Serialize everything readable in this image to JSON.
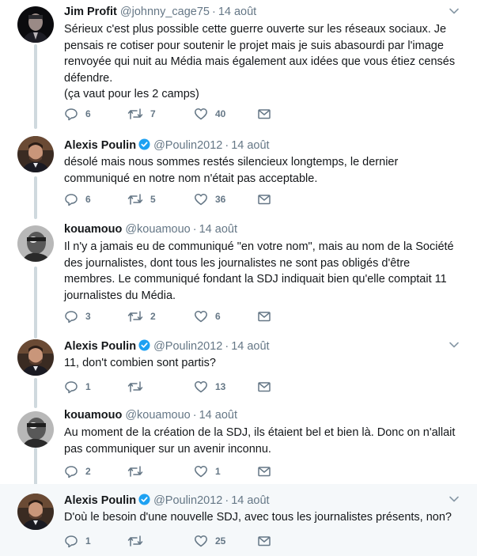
{
  "tweets": [
    {
      "display_name": "Jim Profit",
      "handle": "@johnny_cage75",
      "time": "14 août",
      "verified": false,
      "text": "Sérieux c'est plus possible cette guerre ouverte sur les réseaux sociaux. Je pensais re cotiser pour soutenir le projet mais je suis abasourdi par l'image renvoyée qui nuit au Média mais également aux idées que vous étiez censés défendre.\n(ça vaut pour les 2 camps)",
      "replies": "6",
      "retweets": "7",
      "likes": "40"
    },
    {
      "display_name": "Alexis Poulin",
      "handle": "@Poulin2012",
      "time": "14 août",
      "verified": true,
      "text": "désolé mais nous sommes restés silencieux longtemps, le dernier communiqué en notre nom n'était pas acceptable.",
      "replies": "6",
      "retweets": "5",
      "likes": "36"
    },
    {
      "display_name": "kouamouo",
      "handle": "@kouamouo",
      "time": "14 août",
      "verified": false,
      "text": "Il n'y a jamais eu de communiqué \"en votre nom\", mais au nom de la Société des journalistes, dont tous les journalistes ne sont pas obligés d'être membres. Le communiqué fondant la SDJ indiquait bien qu'elle comptait 11 journalistes du Média.",
      "replies": "3",
      "retweets": "2",
      "likes": "6"
    },
    {
      "display_name": "Alexis Poulin",
      "handle": "@Poulin2012",
      "time": "14 août",
      "verified": true,
      "text": "11, don't combien sont partis?",
      "replies": "1",
      "retweets": "",
      "likes": "13"
    },
    {
      "display_name": "kouamouo",
      "handle": "@kouamouo",
      "time": "14 août",
      "verified": false,
      "text": "Au moment de la création de la SDJ, ils étaient bel et bien là. Donc on n'allait pas communiquer sur un avenir inconnu.",
      "replies": "2",
      "retweets": "",
      "likes": "1"
    },
    {
      "display_name": "Alexis Poulin",
      "handle": "@Poulin2012",
      "time": "14 août",
      "verified": true,
      "text": "D'où le besoin d'une nouvelle SDJ, avec tous les journalistes présents, non?",
      "replies": "1",
      "retweets": "",
      "likes": "25"
    }
  ],
  "separator": "·",
  "colors": {
    "accent": "#1da1f2",
    "secondary_text": "#657786",
    "thread_line": "#cfd9de",
    "highlight_bg": "#f5f8fa"
  },
  "icons": [
    "reply-icon",
    "retweet-icon",
    "like-icon",
    "direct-message-icon",
    "chevron-down-icon",
    "verified-badge-icon"
  ]
}
